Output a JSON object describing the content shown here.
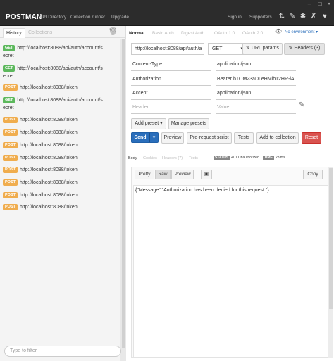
{
  "topbar": {
    "brand": "POSTMAN",
    "nav": [
      "API Directory",
      "Collection runner",
      "Upgrade"
    ],
    "signin": "Sign in",
    "supporters": "Supporters"
  },
  "sidebar": {
    "tab_history": "History",
    "tab_collections": "Collections",
    "items": [
      {
        "method": "GET",
        "url": "http://localhost:8088/api/auth/account/s",
        "url2": "ecret"
      },
      {
        "method": "GET",
        "url": "http://localhost:8088/api/auth/account/s",
        "url2": "ecret"
      },
      {
        "method": "POST",
        "url": "http://localhost:8088/token",
        "url2": ""
      },
      {
        "method": "GET",
        "url": "http://localhost:8088/api/auth/account/s",
        "url2": "ecret"
      },
      {
        "method": "POST",
        "url": "http://localhost:8088/token",
        "url2": ""
      },
      {
        "method": "POST",
        "url": "http://localhost:8088/token",
        "url2": ""
      },
      {
        "method": "POST",
        "url": "http://localhost:8088/token",
        "url2": ""
      },
      {
        "method": "POST",
        "url": "http://localhost:8088/token",
        "url2": ""
      },
      {
        "method": "POST",
        "url": "http://localhost:8088/token",
        "url2": ""
      },
      {
        "method": "POST",
        "url": "http://localhost:8088/token",
        "url2": ""
      },
      {
        "method": "POST",
        "url": "http://localhost:8088/token",
        "url2": ""
      },
      {
        "method": "POST",
        "url": "http://localhost:8088/token",
        "url2": ""
      }
    ],
    "filter_placeholder": "Type to filter"
  },
  "auth_tabs": [
    "Normal",
    "Basic Auth",
    "Digest Auth",
    "OAuth 1.0",
    "OAuth 2.0"
  ],
  "environment": "No environment",
  "request": {
    "url": "http://localhost:8088/api/auth/a",
    "method": "GET",
    "url_params_label": "URL params",
    "headers_label": "Headers (3)"
  },
  "headers": [
    {
      "key": "Content-Type",
      "value": "application/json"
    },
    {
      "key": "Authorization",
      "value": "Bearer bTOM23aDLeHMlb12HR-iA"
    },
    {
      "key": "Accept",
      "value": "application/json"
    }
  ],
  "header_placeholder": {
    "key": "Header",
    "value": "Value"
  },
  "presets": {
    "add": "Add preset",
    "manage": "Manage presets"
  },
  "actions": {
    "send": "Send",
    "preview": "Preview",
    "prerequest": "Pre-request script",
    "tests": "Tests",
    "add_collection": "Add to collection",
    "reset": "Reset"
  },
  "response": {
    "tabs": [
      "Body",
      "Cookies",
      "Headers (7)",
      "Tests"
    ],
    "status_label": "STATUS",
    "status_value": "401 Unauthorized",
    "time_label": "TIME",
    "time_value": "28 ms",
    "view_buttons": [
      "Pretty",
      "Raw",
      "Preview"
    ],
    "copy": "Copy",
    "body": "{\"Message\":\"Authorization has been denied for this request.\"}"
  },
  "colors": {
    "send": "#2a6ebb",
    "reset": "#d9534f",
    "get": "#5cb85c",
    "post": "#f0ad4e"
  }
}
